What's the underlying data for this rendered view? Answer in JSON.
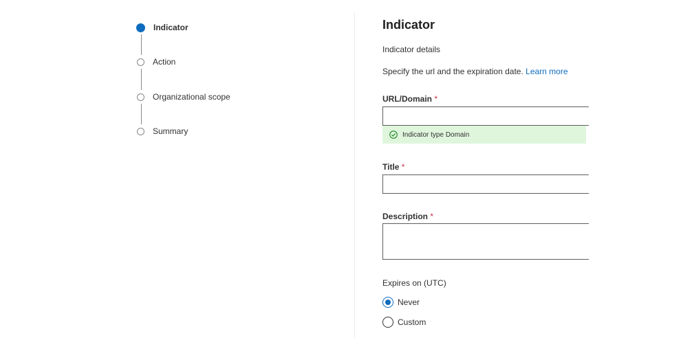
{
  "stepper": {
    "steps": [
      {
        "label": "Indicator",
        "state": "active"
      },
      {
        "label": "Action",
        "state": "pending"
      },
      {
        "label": "Organizational scope",
        "state": "pending"
      },
      {
        "label": "Summary",
        "state": "pending"
      }
    ]
  },
  "form": {
    "title": "Indicator",
    "subtitle": "Indicator details",
    "help_text": "Specify the url and the expiration date.",
    "learn_more": "Learn more",
    "required_marker": "*",
    "url_domain": {
      "label": "URL/Domain",
      "value": "",
      "validation_message": "Indicator type Domain"
    },
    "title_field": {
      "label": "Title",
      "value": ""
    },
    "description_field": {
      "label": "Description",
      "value": ""
    },
    "expires": {
      "label": "Expires on (UTC)",
      "options": [
        {
          "label": "Never",
          "selected": true
        },
        {
          "label": "Custom",
          "selected": false
        }
      ]
    }
  },
  "colors": {
    "accent": "#0f6cbd",
    "success_bg": "#dff6dd",
    "required": "#c4314b"
  }
}
